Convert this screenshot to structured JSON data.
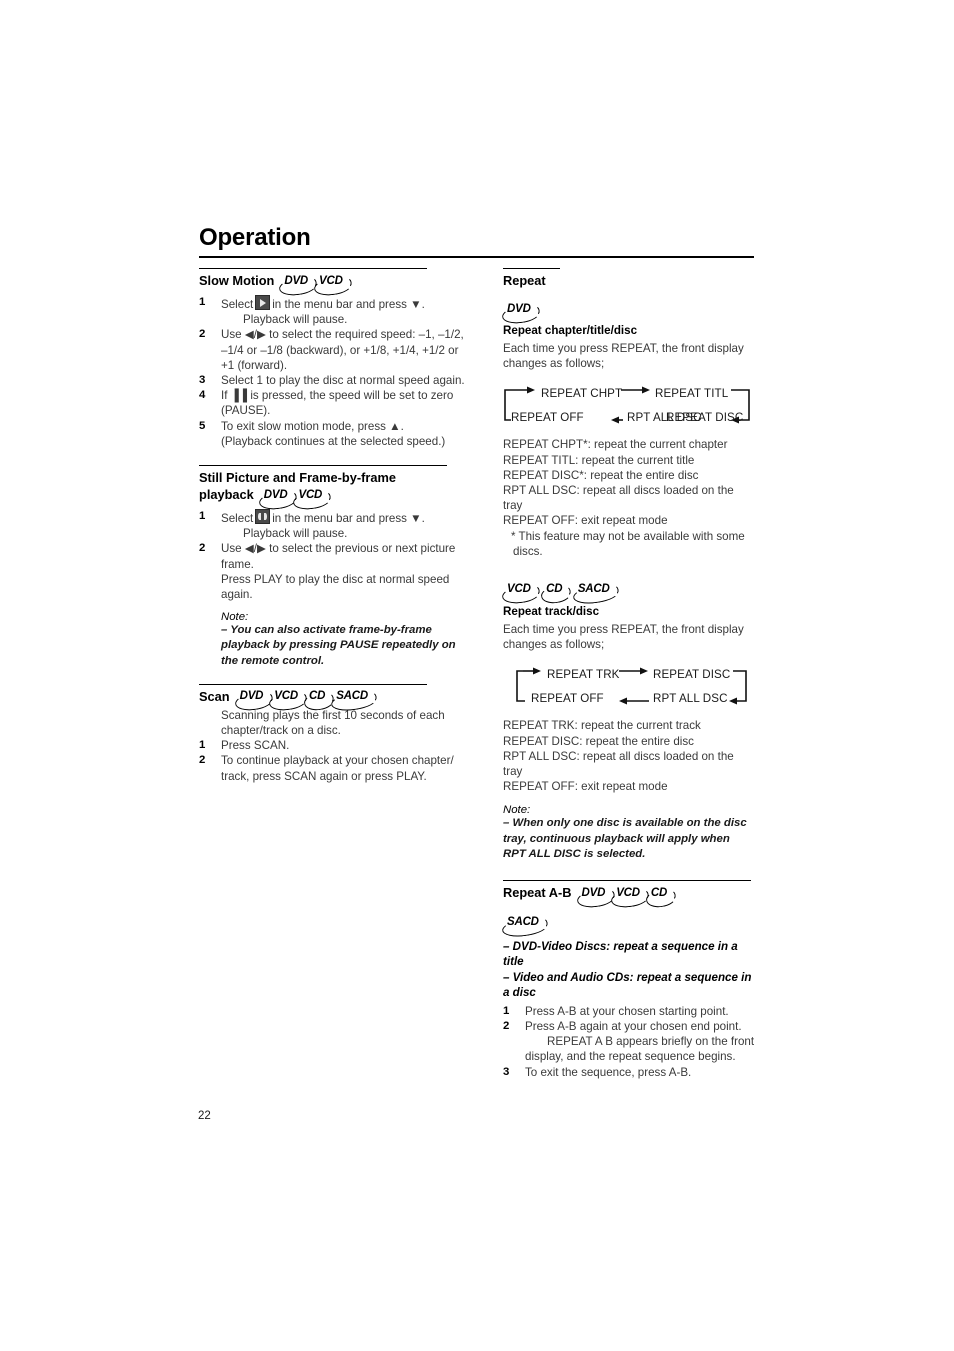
{
  "page": {
    "title": "Operation",
    "number": "22"
  },
  "left_column": {
    "slow_motion": {
      "heading": "Slow Motion",
      "badges": [
        "DVD",
        "VCD"
      ],
      "steps": [
        {
          "num": "1",
          "text": "Select",
          "icon": "play-menu-icon",
          "text_after": "in the menu bar and press ▼.",
          "subline": "Playback will pause."
        },
        {
          "num": "2",
          "text": "Use ◀/▶ to select the required speed: –1, –1/2, –1/4 or –1/8 (backward), or +1/8, +1/4, +1/2 or +1 (forward)."
        },
        {
          "num": "3",
          "text": "Select 1 to play the disc at normal speed again."
        },
        {
          "num": "4",
          "text": "If ▐▐ is pressed, the speed will be set to zero (PAUSE)."
        },
        {
          "num": "5",
          "text": "To exit slow motion mode, press ▲.",
          "flushline": "(Playback continues at the selected speed.)"
        }
      ]
    },
    "still_picture": {
      "heading_line1": "Still Picture and Frame-by-frame",
      "heading_line2": "playback",
      "badges": [
        "DVD",
        "VCD"
      ],
      "steps": [
        {
          "num": "1",
          "text": "Select",
          "icon": "frame-step-icon",
          "text_after": "in the menu bar and press ▼.",
          "subline": "Playback will pause."
        },
        {
          "num": "2",
          "text": "Use ◀/▶ to select the previous or next picture frame.",
          "flushline": "Press PLAY to play the disc at normal speed again."
        }
      ],
      "note_label": "Note:",
      "note_text": "– You can also activate frame-by-frame playback by pressing PAUSE repeatedly on the remote control."
    },
    "scan": {
      "heading": "Scan",
      "badges": [
        "DVD",
        "VCD",
        "CD",
        "SACD"
      ],
      "intro": "Scanning plays the first 10 seconds of each chapter/track on a disc.",
      "steps": [
        {
          "num": "1",
          "text": "Press SCAN."
        },
        {
          "num": "2",
          "text": "To continue playback at your chosen chapter/ track, press SCAN again or press PLAY."
        }
      ]
    }
  },
  "right_column": {
    "repeat": {
      "heading": "Repeat",
      "badges": [
        "DVD"
      ],
      "sub_heading": "Repeat chapter/title/disc",
      "intro": "Each time you press REPEAT, the front display changes as follows;",
      "flow_top": [
        "REPEAT CHPT",
        "REPEAT TITL"
      ],
      "flow_bottom": [
        "REPEAT OFF",
        "RPT ALL DSC",
        "REPEAT DISC"
      ],
      "definitions": [
        "REPEAT CHPT*: repeat the current chapter",
        "REPEAT TITL: repeat the current title",
        "REPEAT DISC*: repeat the entire disc",
        "RPT ALL DSC: repeat all discs loaded on the tray",
        "REPEAT OFF: exit repeat mode"
      ],
      "footnote": "* This feature may not be available with some discs."
    },
    "repeat_track": {
      "badges": [
        "VCD",
        "CD",
        "SACD"
      ],
      "sub_heading": "Repeat track/disc",
      "intro": "Each time you press REPEAT, the front display changes as follows;",
      "flow_top": [
        "REPEAT TRK",
        "REPEAT DISC"
      ],
      "flow_bottom": [
        "REPEAT OFF",
        "RPT ALL DSC"
      ],
      "definitions": [
        "REPEAT TRK: repeat the current track",
        "REPEAT DISC: repeat the entire disc",
        "RPT ALL DSC: repeat all discs loaded on the tray",
        "REPEAT OFF: exit repeat mode"
      ],
      "note_label": "Note:",
      "note_text": "– When only one disc is available on the disc tray, continuous playback will apply when RPT ALL DISC is selected."
    },
    "repeat_ab": {
      "heading": "Repeat A-B",
      "badges": [
        "DVD",
        "VCD",
        "CD"
      ],
      "badges_line2": [
        "SACD"
      ],
      "bullet1": "–  DVD-Video Discs: repeat a sequence in a title",
      "bullet2": "–  Video and Audio CDs: repeat a sequence in a disc",
      "steps": [
        {
          "num": "1",
          "text": "Press A-B at your chosen starting point."
        },
        {
          "num": "2",
          "text": "Press A-B again at your chosen end point.",
          "subline": "REPEAT A B appears briefly on the front",
          "flushline": "display, and the repeat sequence begins."
        },
        {
          "num": "3",
          "text": "To exit the sequence, press A-B."
        }
      ]
    }
  }
}
